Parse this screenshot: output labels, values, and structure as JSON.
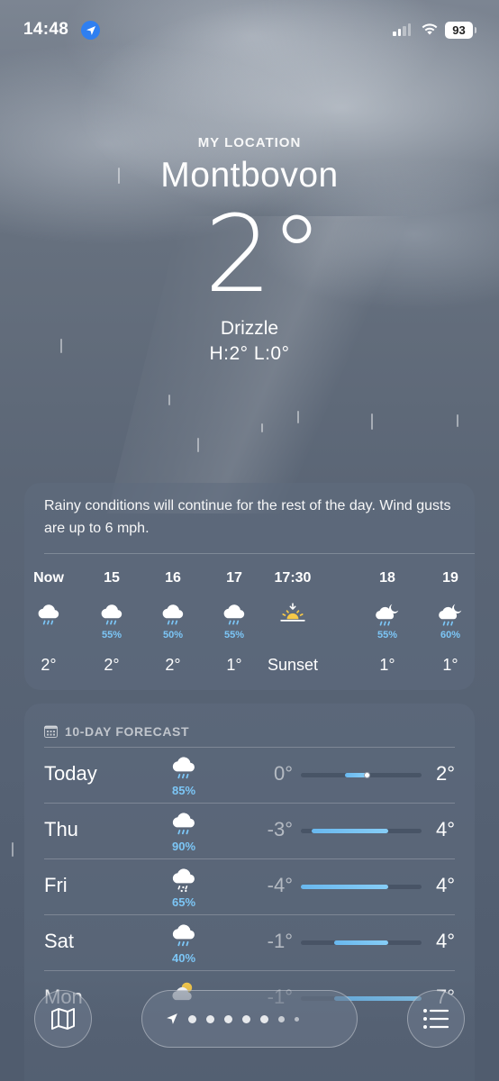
{
  "status_bar": {
    "time": "14:48",
    "battery": "93",
    "icons": [
      "location-arrow-icon",
      "cellular-signal-icon",
      "wifi-icon",
      "battery-icon"
    ]
  },
  "location": {
    "label": "MY LOCATION",
    "city": "Montbovon",
    "temperature": "2°",
    "condition": "Drizzle",
    "high_low": "H:2°  L:0°"
  },
  "hourly": {
    "summary": "Rainy conditions will continue for the rest of the day. Wind gusts are up to 6 mph.",
    "items": [
      {
        "time": "Now",
        "icon": "rain-cloud-icon",
        "precip": "",
        "temp": "2°"
      },
      {
        "time": "15",
        "icon": "rain-cloud-icon",
        "precip": "55%",
        "temp": "2°"
      },
      {
        "time": "16",
        "icon": "rain-cloud-icon",
        "precip": "50%",
        "temp": "2°"
      },
      {
        "time": "17",
        "icon": "rain-cloud-icon",
        "precip": "55%",
        "temp": "1°"
      },
      {
        "time": "17:30",
        "icon": "sunset-icon",
        "precip": "",
        "temp": "Sunset"
      },
      {
        "time": "18",
        "icon": "moon-rain-cloud-icon",
        "precip": "55%",
        "temp": "1°"
      },
      {
        "time": "19",
        "icon": "moon-rain-cloud-icon",
        "precip": "60%",
        "temp": "1°"
      }
    ]
  },
  "daily": {
    "header": "10-DAY FORECAST",
    "header_icon": "calendar-icon",
    "scale_min": -4,
    "scale_max": 7,
    "days": [
      {
        "day": "Today",
        "icon": "rain-cloud-icon",
        "precip": "85%",
        "low": "0°",
        "high": "2°",
        "low_val": 0,
        "high_val": 2,
        "current": 2
      },
      {
        "day": "Thu",
        "icon": "rain-cloud-icon",
        "precip": "90%",
        "low": "-3°",
        "high": "4°",
        "low_val": -3,
        "high_val": 4
      },
      {
        "day": "Fri",
        "icon": "sleet-cloud-icon",
        "precip": "65%",
        "low": "-4°",
        "high": "4°",
        "low_val": -4,
        "high_val": 4
      },
      {
        "day": "Sat",
        "icon": "rain-cloud-icon",
        "precip": "40%",
        "low": "-1°",
        "high": "4°",
        "low_val": -1,
        "high_val": 4
      },
      {
        "day": "Mon",
        "icon": "partly-cloudy-icon",
        "precip": "",
        "low": "-1°",
        "high": "7°",
        "low_val": -1,
        "high_val": 7
      }
    ]
  },
  "toolbar": {
    "map_icon": "map-icon",
    "list_icon": "list-icon",
    "pager_icon": "location-arrow-icon",
    "page_dots": 7
  }
}
